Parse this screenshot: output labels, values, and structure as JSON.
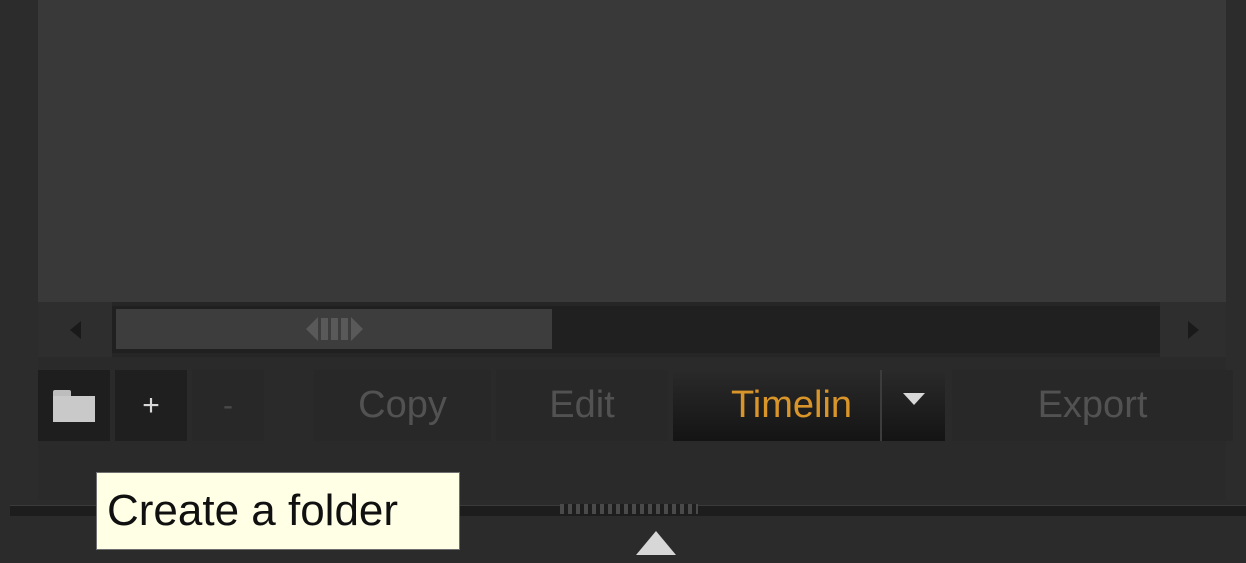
{
  "toolbar": {
    "folder_icon": "folder-icon",
    "plus_label": "+",
    "minus_label": "-",
    "copy_label": "Copy",
    "edit_label": "Edit",
    "timeline_label": "Timelin",
    "timeline_dropdown_icon": "chevron-down-icon",
    "export_label": "Export"
  },
  "tooltip": {
    "text": "Create a folder"
  },
  "colors": {
    "accent_active": "#d9952a",
    "tooltip_bg": "#ffffe6",
    "panel_bg": "#393939"
  }
}
